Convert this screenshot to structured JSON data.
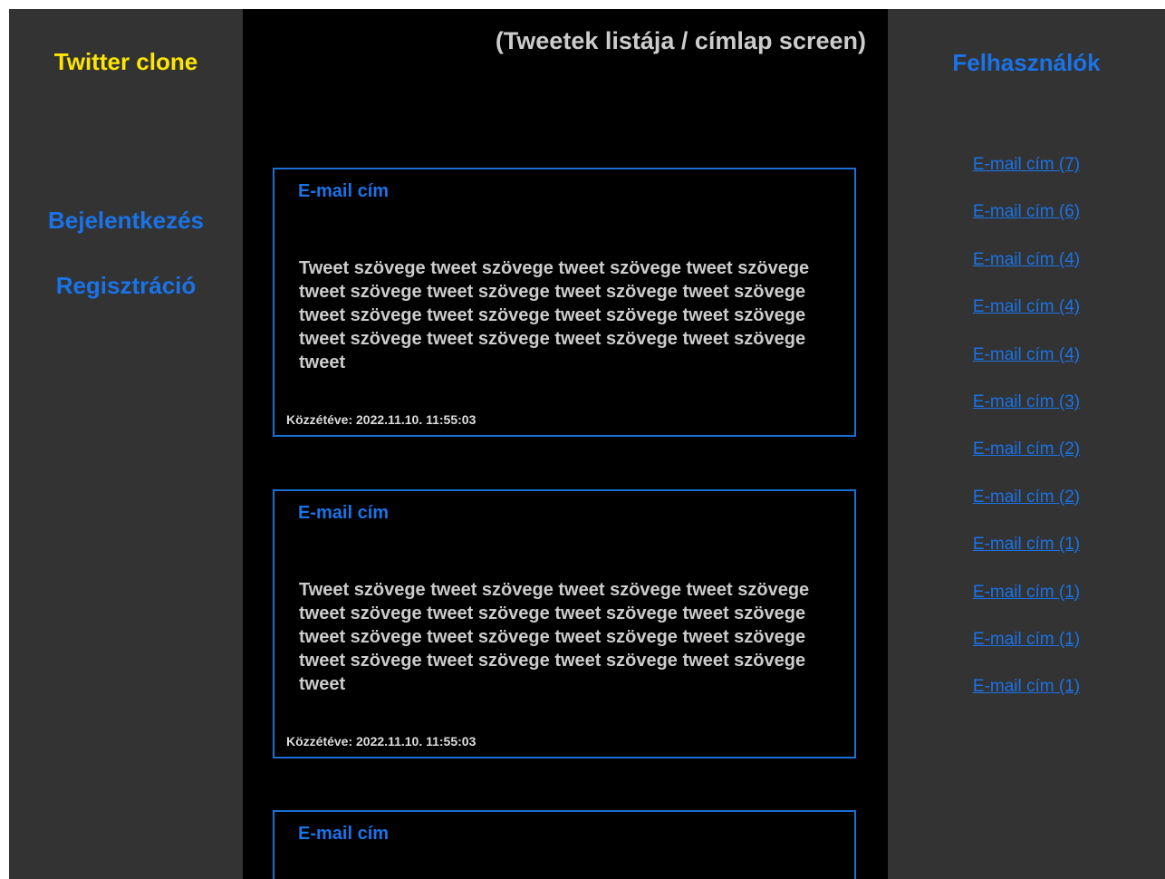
{
  "left": {
    "brand": "Twitter clone",
    "nav": {
      "login": "Bejelentkezés",
      "register": "Regisztráció"
    }
  },
  "center": {
    "title": "(Tweetek listája / címlap screen)",
    "tweets": [
      {
        "author": "E-mail cím",
        "text": "Tweet szövege tweet szövege tweet szövege tweet szövege tweet szövege tweet szövege tweet szövege tweet szövege tweet szövege tweet szövege tweet szövege tweet szövege tweet szövege tweet szövege tweet szövege tweet szövege tweet",
        "date": "Közzétéve: 2022.11.10. 11:55:03"
      },
      {
        "author": "E-mail cím",
        "text": "Tweet szövege tweet szövege tweet szövege tweet szövege tweet szövege tweet szövege tweet szövege tweet szövege tweet szövege tweet szövege tweet szövege tweet szövege tweet szövege tweet szövege tweet szövege tweet szövege tweet",
        "date": "Közzétéve: 2022.11.10. 11:55:03"
      },
      {
        "author": "E-mail cím",
        "text": "",
        "date": ""
      }
    ]
  },
  "right": {
    "title": "Felhasználók",
    "users": [
      "E-mail cím (7)",
      "E-mail cím (6)",
      "E-mail cím (4)",
      "E-mail cím (4)",
      "E-mail cím (4)",
      "E-mail cím (3)",
      "E-mail cím (2)",
      "E-mail cím (2)",
      "E-mail cím (1)",
      "E-mail cím (1)",
      "E-mail cím (1)",
      "E-mail cím (1)"
    ]
  },
  "colors": {
    "brand": "#ffe600",
    "accent": "#1a73e8",
    "sidebar_bg": "#333333",
    "main_bg": "#000000",
    "card_border": "#1a6fd6",
    "text_gray": "#cccccc"
  }
}
